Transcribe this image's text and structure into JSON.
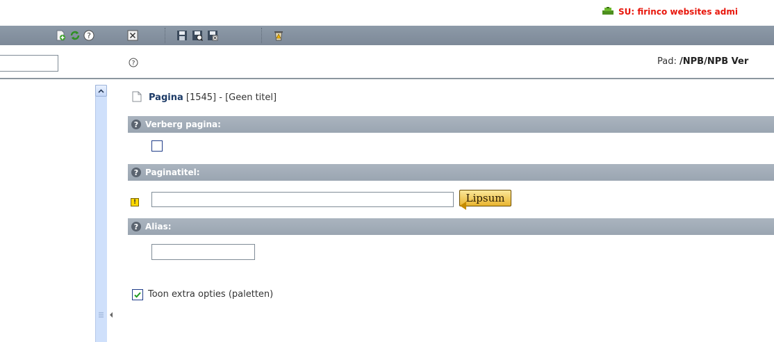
{
  "header": {
    "su_label": "SU:  firinco websites admi"
  },
  "toolbar": {
    "left_icons": [
      "new-page-icon",
      "refresh-icon",
      "help-icon"
    ],
    "main_icons": [
      "close-icon",
      "save-icon",
      "save-view-icon",
      "save-close-icon",
      "delete-icon"
    ]
  },
  "subbar": {
    "search_value": "",
    "path_label": "Pad:",
    "path_value": "/NPB/NPB Ver"
  },
  "form": {
    "page_label": "Pagina",
    "page_rest": " [1545] - [Geen titel]",
    "sections": {
      "verberg": "Verberg pagina:",
      "paginatitel": "Paginatitel:",
      "alias": "Alias:"
    },
    "verberg_checked": false,
    "paginatitel_value": "",
    "lipsum_label": "Lipsum",
    "alias_value": "",
    "extra_options_label": "Toon extra opties (paletten)",
    "extra_options_checked": true
  },
  "colors": {
    "su_text": "#e8170c",
    "toolbar": "#8592a0",
    "section_bar": "#a1abb7",
    "scroll_track": "#cfe0fb",
    "lipsum": "#f3cd5e"
  }
}
